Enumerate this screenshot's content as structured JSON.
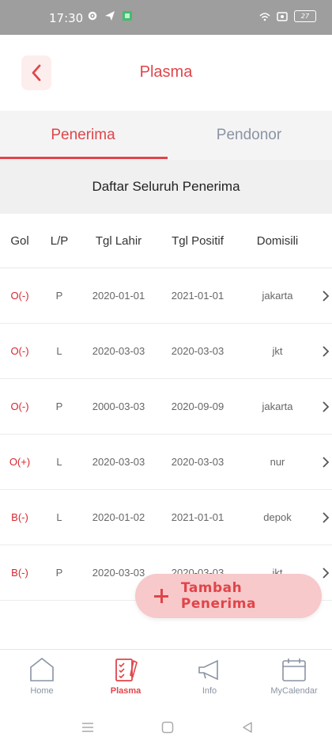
{
  "status_bar": {
    "time": "17:30",
    "battery": "27"
  },
  "app_bar": {
    "title": "Plasma"
  },
  "tabs": [
    {
      "label": "Penerima",
      "active": true
    },
    {
      "label": "Pendonor",
      "active": false
    }
  ],
  "section_title": "Daftar Seluruh Penerima",
  "table": {
    "headers": {
      "gol": "Gol",
      "lp": "L/P",
      "tgl_lahir": "Tgl Lahir",
      "tgl_positif": "Tgl Positif",
      "domisili": "Domisili"
    },
    "rows": [
      {
        "gol": "O(-)",
        "lp": "P",
        "tgl_lahir": "2020-01-01",
        "tgl_positif": "2021-01-01",
        "domisili": "jakarta"
      },
      {
        "gol": "O(-)",
        "lp": "L",
        "tgl_lahir": "2020-03-03",
        "tgl_positif": "2020-03-03",
        "domisili": "jkt"
      },
      {
        "gol": "O(-)",
        "lp": "P",
        "tgl_lahir": "2000-03-03",
        "tgl_positif": "2020-09-09",
        "domisili": "jakarta"
      },
      {
        "gol": "O(+)",
        "lp": "L",
        "tgl_lahir": "2020-03-03",
        "tgl_positif": "2020-03-03",
        "domisili": "nur"
      },
      {
        "gol": "B(-)",
        "lp": "L",
        "tgl_lahir": "2020-01-02",
        "tgl_positif": "2021-01-01",
        "domisili": "depok"
      },
      {
        "gol": "B(-)",
        "lp": "P",
        "tgl_lahir": "2020-03-03",
        "tgl_positif": "2020-03-03",
        "domisili": "jkt"
      }
    ]
  },
  "fab": {
    "label": "Tambah Penerima"
  },
  "bottom_nav": [
    {
      "label": "Home",
      "icon": "home-icon"
    },
    {
      "label": "Plasma",
      "icon": "clipboard-check-icon",
      "active": true
    },
    {
      "label": "Info",
      "icon": "megaphone-icon"
    },
    {
      "label": "MyCalendar",
      "icon": "calendar-icon"
    }
  ],
  "colors": {
    "accent": "#e0454a",
    "accent_soft": "#f7c9ca",
    "muted": "#8a93a3"
  }
}
